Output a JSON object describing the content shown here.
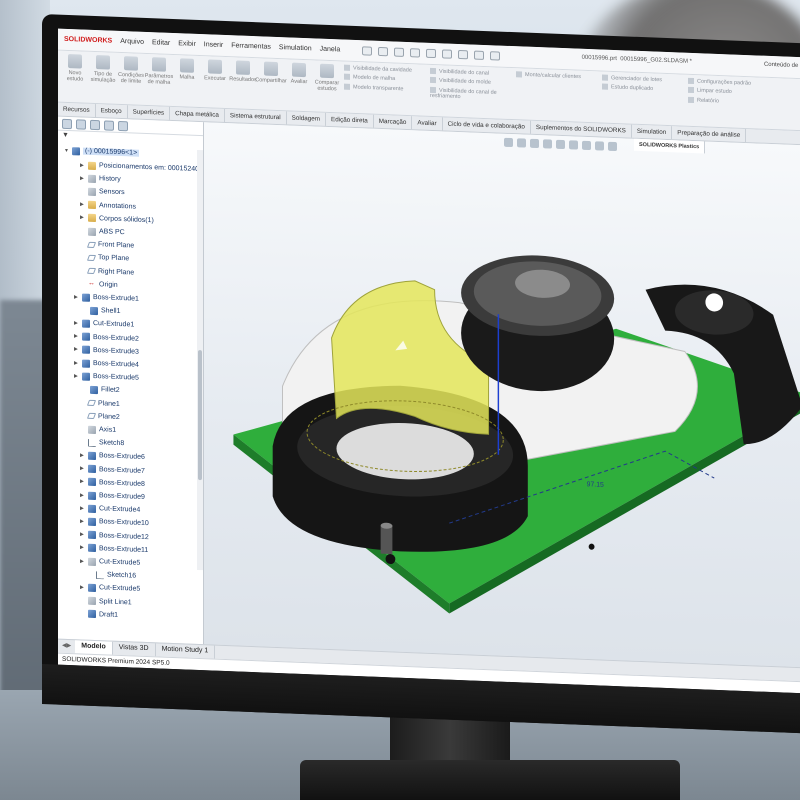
{
  "app": {
    "brand": "SOLIDWORKS",
    "document_name": "00015996.prt",
    "document_name_right": "00015996_G02.SLDASM *",
    "account": "Conteúdo de pesquisa"
  },
  "menu": [
    "Arquivo",
    "Editar",
    "Exibir",
    "Inserir",
    "Ferramentas",
    "Simulation",
    "Janela"
  ],
  "ribbon": {
    "buttons": [
      {
        "label": "Novo estudo"
      },
      {
        "label": "Tipo de simulação"
      },
      {
        "label": "Condições de limite"
      },
      {
        "label": "Parâmetros de malha"
      },
      {
        "label": "Malha"
      },
      {
        "label": "Executar"
      },
      {
        "label": "Resultados"
      },
      {
        "label": "Compartilhar"
      },
      {
        "label": "Avaliar"
      },
      {
        "label": "Comparar estudos"
      }
    ],
    "group1": [
      "Visibilidade da cavidade",
      "Modelo de malha",
      "Modelo transparente"
    ],
    "group2": [
      "Visibilidade do canal",
      "Visibilidade do molde",
      "Visibilidade do canal de resfriamento"
    ],
    "group3": [
      "Monte/calcular clientes"
    ],
    "group4": [
      "Gerenciador de lotes",
      "Estudo duplicado"
    ],
    "group5": [
      "Configurações padrão",
      "Limpar estudo",
      "Relatório"
    ]
  },
  "tabs": [
    "Recursos",
    "Esboço",
    "Superfícies",
    "Chapa metálica",
    "Sistema estrutural",
    "Soldagem",
    "Edição direta",
    "Marcação",
    "Avaliar",
    "Ciclo de vida e colaboração",
    "Suplementos do SOLIDWORKS",
    "Simulation",
    "Preparação de análise",
    "SOLIDWORKS Plastics"
  ],
  "active_tab": "SOLIDWORKS Plastics",
  "tree": {
    "root": "(-) 00015996<1>",
    "nodes": [
      "Posicionamentos em: 00015240",
      "History",
      "Sensors",
      "Annotations",
      "Corpos sólidos(1)",
      "ABS PC",
      "Front Plane",
      "Top Plane",
      "Right Plane",
      "Origin",
      "Boss-Extrude1",
      "Shell1",
      "Cut-Extrude1",
      "Boss-Extrude2",
      "Boss-Extrude3",
      "Boss-Extrude4",
      "Boss-Extrude5",
      "Fillet2",
      "Plane1",
      "Plane2",
      "Axis1",
      "Sketch8",
      "Boss-Extrude6",
      "Boss-Extrude7",
      "Boss-Extrude8",
      "Boss-Extrude9",
      "Cut-Extrude4",
      "Boss-Extrude10",
      "Boss-Extrude12",
      "Boss-Extrude11",
      "Cut-Extrude5",
      "Sketch16",
      "Cut-Extrude5",
      "Split Line1",
      "Draft1"
    ]
  },
  "bottom_tabs": [
    "Modelo",
    "Vistas 3D",
    "Motion Study 1"
  ],
  "active_bottom_tab": "Modelo",
  "status_bar": "SOLIDWORKS Premium 2024 SP5.0",
  "viewport": {
    "dimension_label": "97.15"
  },
  "colors": {
    "brand_red": "#d01c1c",
    "pcb_green": "#2fae3c",
    "highlight_yellow": "#e4e65a",
    "selection_blue": "#3b7de0"
  }
}
